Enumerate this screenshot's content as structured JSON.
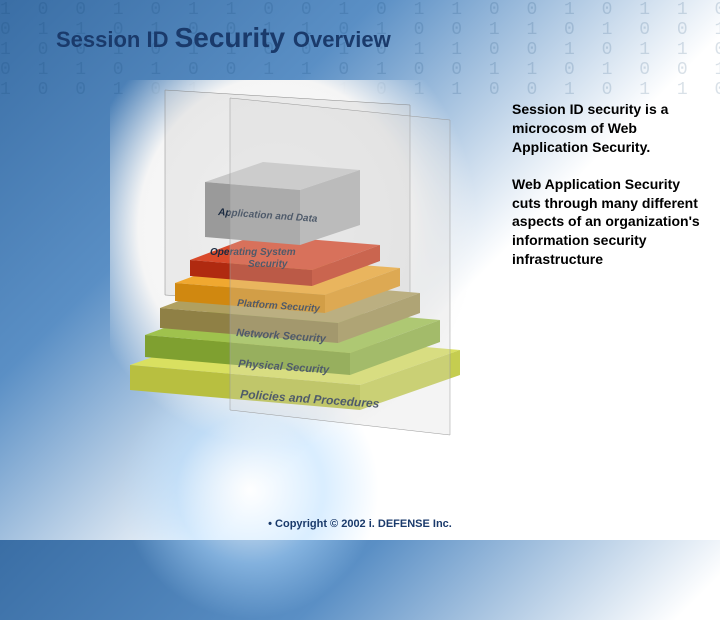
{
  "title": {
    "part1": "Session ID ",
    "part2": "Security ",
    "part3": "Overview"
  },
  "diagram": {
    "layers": [
      {
        "label": "Application and Data",
        "color": "#b8b8b8"
      },
      {
        "label": "Operating System Security",
        "color": "#d94a2b"
      },
      {
        "label": "Platform Security",
        "color": "#f0a830"
      },
      {
        "label": "Network Security",
        "color": "#b0a060"
      },
      {
        "label": "Physical Security",
        "color": "#9fc24d"
      },
      {
        "label": "Policies and Procedures",
        "color": "#d9e060"
      }
    ]
  },
  "body": {
    "p1": "Session ID security is a microcosm of Web Application Security.",
    "p2": "Web Application Security cuts through many different aspects of an organization's information security infrastructure"
  },
  "footer": "• Copyright © 2002 i. DEFENSE Inc."
}
